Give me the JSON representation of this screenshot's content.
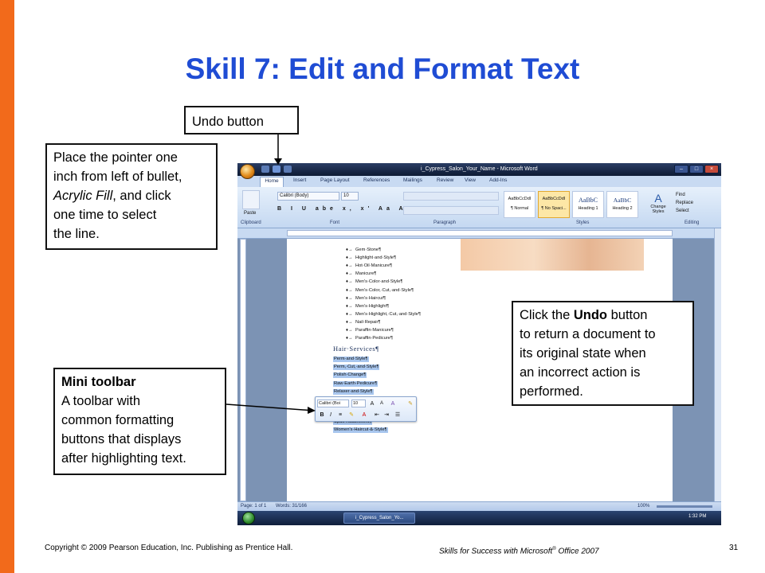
{
  "slide": {
    "title": "Skill 7: Edit and Format Text",
    "accent_color": "#f26a1b",
    "title_color": "#1f4cd4"
  },
  "callouts": {
    "undo": "Undo button",
    "pointer_lines": [
      "Place the pointer one",
      "inch from left of bullet,",
      "Acrylic Fill, and click",
      "one time to select",
      "the line."
    ],
    "pointer_italic": "Acrylic Fill",
    "undo_desc_prefix": "Click the ",
    "undo_desc_bold": "Undo",
    "undo_desc_lines": [
      " button",
      "to return a document to",
      "its original state when",
      "an incorrect action is",
      "performed."
    ],
    "mini_title": "Mini toolbar",
    "mini_lines": [
      "A toolbar with",
      "common formatting",
      "buttons that displays",
      "after highlighting  text."
    ]
  },
  "footer": {
    "copyright": "Copyright © 2009 Pearson Education, Inc. Publishing as Prentice Hall.",
    "book_prefix": "Skills for Success with Microsoft",
    "book_suffix": " Office 2007",
    "page": "31"
  },
  "word": {
    "window_title": "i_Cypress_Salon_Your_Name - Microsoft Word",
    "tabs": [
      "Home",
      "Insert",
      "Page Layout",
      "References",
      "Mailings",
      "Review",
      "View",
      "Add-Ins"
    ],
    "groups": [
      "Clipboard",
      "Font",
      "Paragraph",
      "Styles",
      "Editing"
    ],
    "paste_label": "Paste",
    "font_name": "Calibri (Body)",
    "font_size": "10",
    "styles": [
      {
        "preview": "AaBbCcDdI",
        "name": "¶ Normal"
      },
      {
        "preview": "AaBbCcDdI",
        "name": "¶ No Spaci..."
      },
      {
        "preview": "AaBbC",
        "name": "Heading 1"
      },
      {
        "preview": "AaBbC",
        "name": "Heading 2"
      }
    ],
    "change_styles": "Change Styles",
    "editing": [
      "Find",
      "Replace",
      "Select"
    ],
    "bullets": [
      "Gem·Stone¶",
      "Highlight·and·Style¶",
      "Hot·Oil·Manicure¶",
      "Manicure¶",
      "Men's·Color·and·Style¶",
      "Men's·Color,·Cut,·and·Style¶",
      "Men's·Haircut¶",
      "Men's·Highlight¶",
      "Men's·Highlight,·Cut,·and·Style¶",
      "Nail·Repair¶",
      "Paraffin·Manicure¶",
      "Paraffin·Pedicure¶"
    ],
    "section_heading": "Hair·Services¶",
    "selected_lines_top": [
      "Perm·and·Style¶",
      "Perm,·Cut,·and·Style¶",
      "Polish·Change¶",
      "Raw·Earth·Pedicure¶",
      "Relaxer·and·Style¶"
    ],
    "selected_lines_bottom": [
      "Updo·Attachment¶",
      "Women's·Haircut·&·Style¶"
    ],
    "mini_font": "Calibri (Boi",
    "mini_size": "10",
    "status_page": "Page: 1 of 1",
    "status_words": "Words: 31/166",
    "zoom": "100%",
    "taskbar_item": "i_Cypress_Salon_Yo...",
    "clock": "1:32 PM"
  }
}
